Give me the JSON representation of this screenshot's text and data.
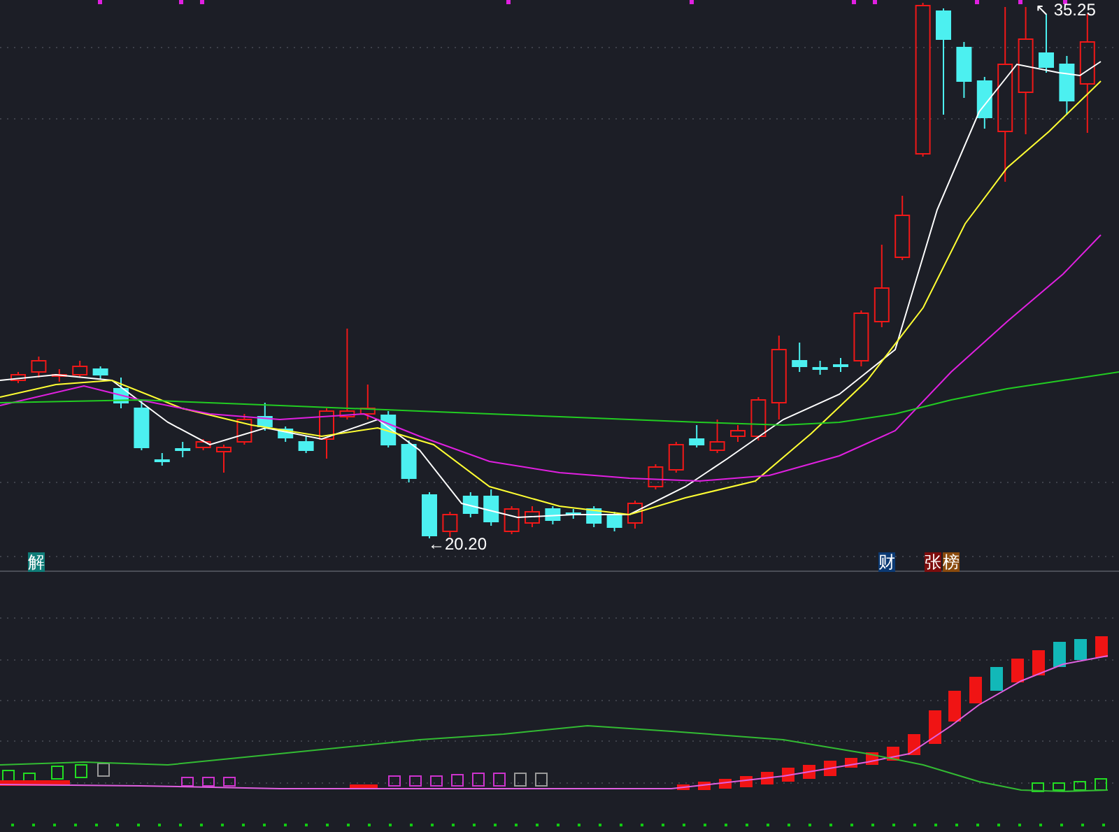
{
  "price_chart": {
    "high_label": {
      "text": "35.25",
      "arrow": "↖"
    },
    "low_label": {
      "text": "20.20",
      "arrow": "←"
    }
  },
  "event_badges": [
    {
      "text": "解",
      "color": "#0f7d78"
    },
    {
      "text": "财",
      "color": "#0b3a74"
    },
    {
      "text": "张",
      "color": "#7d0c0c"
    },
    {
      "text": "榜",
      "color": "#8a4a0c"
    }
  ]
}
